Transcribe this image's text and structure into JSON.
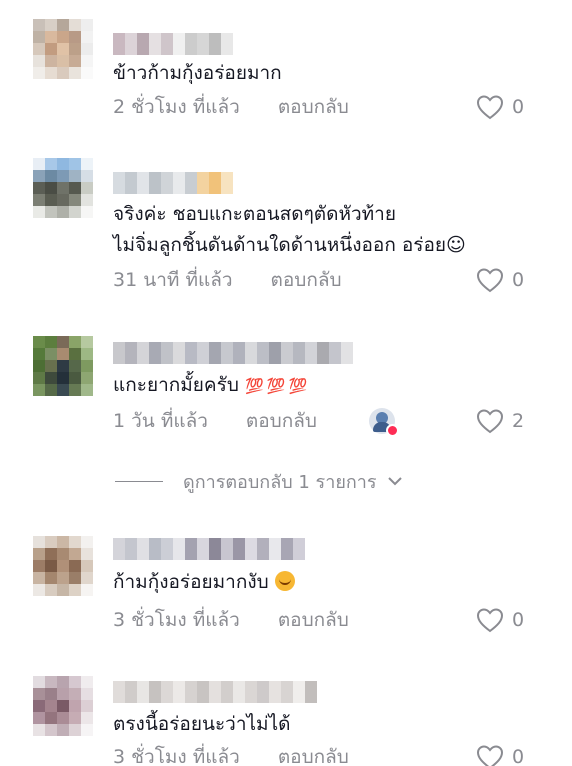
{
  "comments": [
    {
      "text": "ข้าวก้ามกุ้งอร่อยมาก",
      "time": "2 ชั่วโมง ที่แล้ว",
      "reply": "ตอบกลับ",
      "likes": "0",
      "avatar_colors": [
        "#c9c0b8",
        "#d8cfc6",
        "#b5a79a",
        "#e4ddd6",
        "#eeeeee",
        "#bfb2a5",
        "#d9b99e",
        "#caa68a",
        "#b89a86",
        "#f2f2f2",
        "#d6c8bb",
        "#c29c80",
        "#e0c2a6",
        "#bca089",
        "#ececec",
        "#e7e2dc",
        "#cdb4a0",
        "#d9bfa6",
        "#c7ab95",
        "#f5f5f5",
        "#f0ede9",
        "#e6dcd2",
        "#d9cabd",
        "#e9e3dc",
        "#fafafa"
      ],
      "name_colors": [
        "#c9b8c0",
        "#dcd3d8",
        "#b8a8b0",
        "#e5e0e2",
        "#cfc5ca",
        "#f0f0f0",
        "#cccccc",
        "#d6d6d6",
        "#bdbdbd",
        "#e8e8e8"
      ]
    },
    {
      "text_line1": "จริงค่ะ ชอบแกะตอนสดๆตัดหัวท้าย",
      "text_line2": "ไม่จิ่มลูกชิ้นดันด้านใดด้านหนึ่งออก อร่อย☺",
      "time": "31 นาที ที่แล้ว",
      "reply": "ตอบกลับ",
      "likes": "0",
      "avatar_colors": [
        "#e8eef5",
        "#a8c8e8",
        "#8fb8e0",
        "#a0c4e6",
        "#edf3f8",
        "#8aa2b8",
        "#6c8aa3",
        "#7d9ab5",
        "#9fb3c4",
        "#d6dee6",
        "#5b5e55",
        "#4a4d45",
        "#6f7268",
        "#56594f",
        "#c9ccc4",
        "#7c7f74",
        "#5a5d52",
        "#67695f",
        "#85887c",
        "#e2e3df",
        "#e9eae6",
        "#c2c4bd",
        "#aeb0a8",
        "#d2d4ce",
        "#f6f6f5"
      ],
      "name_colors": [
        "#d6dbe0",
        "#c4cad0",
        "#e1e4e8",
        "#bcc2c8",
        "#d0d4d8",
        "#e8eaec",
        "#c8cdd2",
        "#f3d3a0",
        "#f1c27a",
        "#f7e3c0"
      ]
    },
    {
      "text": "แกะยากมั้ยครับ",
      "emojis": "💯 💯 💯",
      "time": "1 วัน ที่แล้ว",
      "reply": "ตอบกลับ",
      "likes": "2",
      "avatar_colors": [
        "#6a8c4a",
        "#5c7e3e",
        "#7a6a58",
        "#8aa468",
        "#b6c9a0",
        "#557a3a",
        "#7b8f64",
        "#a88b70",
        "#5a7040",
        "#9db884",
        "#4d6e34",
        "#68704e",
        "#2e3a44",
        "#56684a",
        "#7e9a60",
        "#5f7a46",
        "#3e4a3c",
        "#24303a",
        "#4a5a40",
        "#8ea672",
        "#7a9660",
        "#566a48",
        "#3a4a52",
        "#667a54",
        "#a0b88a"
      ],
      "name_colors": [
        "#c8c8cc",
        "#b4b4bc",
        "#d4d4d8",
        "#a8aab4",
        "#c0c2c8",
        "#dadadc",
        "#b8bac4",
        "#cfd0d6",
        "#a4a6b0",
        "#c6c8ce",
        "#b0b2bc",
        "#d8d9dc",
        "#bcbec6",
        "#9ea0aa",
        "#cacbd0",
        "#b6b8c0",
        "#d2d3d8",
        "#aaaaaf",
        "#c4c5cc",
        "#e2e2e4"
      ]
    },
    {
      "text": "ก้ามกุ้งอร่อยมากงับ",
      "time": "3 ชั่วโมง ที่แล้ว",
      "reply": "ตอบกลับ",
      "likes": "0",
      "avatar_colors": [
        "#e6e1dc",
        "#d9ccc0",
        "#cbb7a5",
        "#e2d8ce",
        "#f3f1ef",
        "#b8a08a",
        "#8f6f58",
        "#a88a72",
        "#c2a892",
        "#e8e2dc",
        "#9c7c66",
        "#7a5a46",
        "#b09078",
        "#8a6a54",
        "#d6c8ba",
        "#c8b4a2",
        "#a4866e",
        "#bca28c",
        "#9a7e68",
        "#e0d6cc",
        "#ece8e4",
        "#d8ccc0",
        "#c6b6a6",
        "#ddd2c6",
        "#f6f4f2"
      ],
      "name_colors": [
        "#d4d4da",
        "#c4c6ce",
        "#e0e0e4",
        "#b8bcc6",
        "#ccced6",
        "#e6e6ea",
        "#a4a2b0",
        "#d8d6de",
        "#8c8898",
        "#c8c6d0",
        "#9a96a6",
        "#dcdae2",
        "#b2b0bc",
        "#e8e8ec",
        "#a8a6b4",
        "#d0ced8"
      ]
    },
    {
      "text": "ตรงนี้อร่อยนะว่าไม่ได้",
      "time": "3 ชั่วโมง ที่แล้ว",
      "reply": "ตอบกลับ",
      "likes": "0",
      "avatar_colors": [
        "#e2dce0",
        "#c8b8c0",
        "#b8a4ae",
        "#d6c8d0",
        "#f0ecee",
        "#a89098",
        "#9a808a",
        "#b8a0aa",
        "#c4aeb6",
        "#e6dee2",
        "#8a6a78",
        "#a4848e",
        "#7a5a66",
        "#c0a4ae",
        "#dccfd4",
        "#b094a0",
        "#94747e",
        "#aa8c96",
        "#c6acb4",
        "#ece6e8",
        "#e8e2e4",
        "#d4c6cc",
        "#c0aeb6",
        "#ddd2d6",
        "#f6f4f5"
      ],
      "name_colors": [
        "#e0dcda",
        "#d0ccca",
        "#e8e6e4",
        "#c6c2c0",
        "#dcd8d6",
        "#ece9e7",
        "#d6d2d0",
        "#c8c4c2",
        "#e4e0de",
        "#d2cecc",
        "#eae8e6",
        "#dad6d4",
        "#cecaca",
        "#e6e2e0",
        "#d8d4d2",
        "#f0eeec",
        "#c2bebc"
      ]
    }
  ],
  "view_replies": "ดูการตอบกลับ 1 รายการ",
  "colors": {
    "text": "#161823",
    "muted": "#8a8b91",
    "accent": "#fe2c55"
  },
  "icons": {
    "like": "heart-outline-icon",
    "expand": "chevron-down-icon",
    "creator_liked": "creator-liked-avatar-icon"
  }
}
